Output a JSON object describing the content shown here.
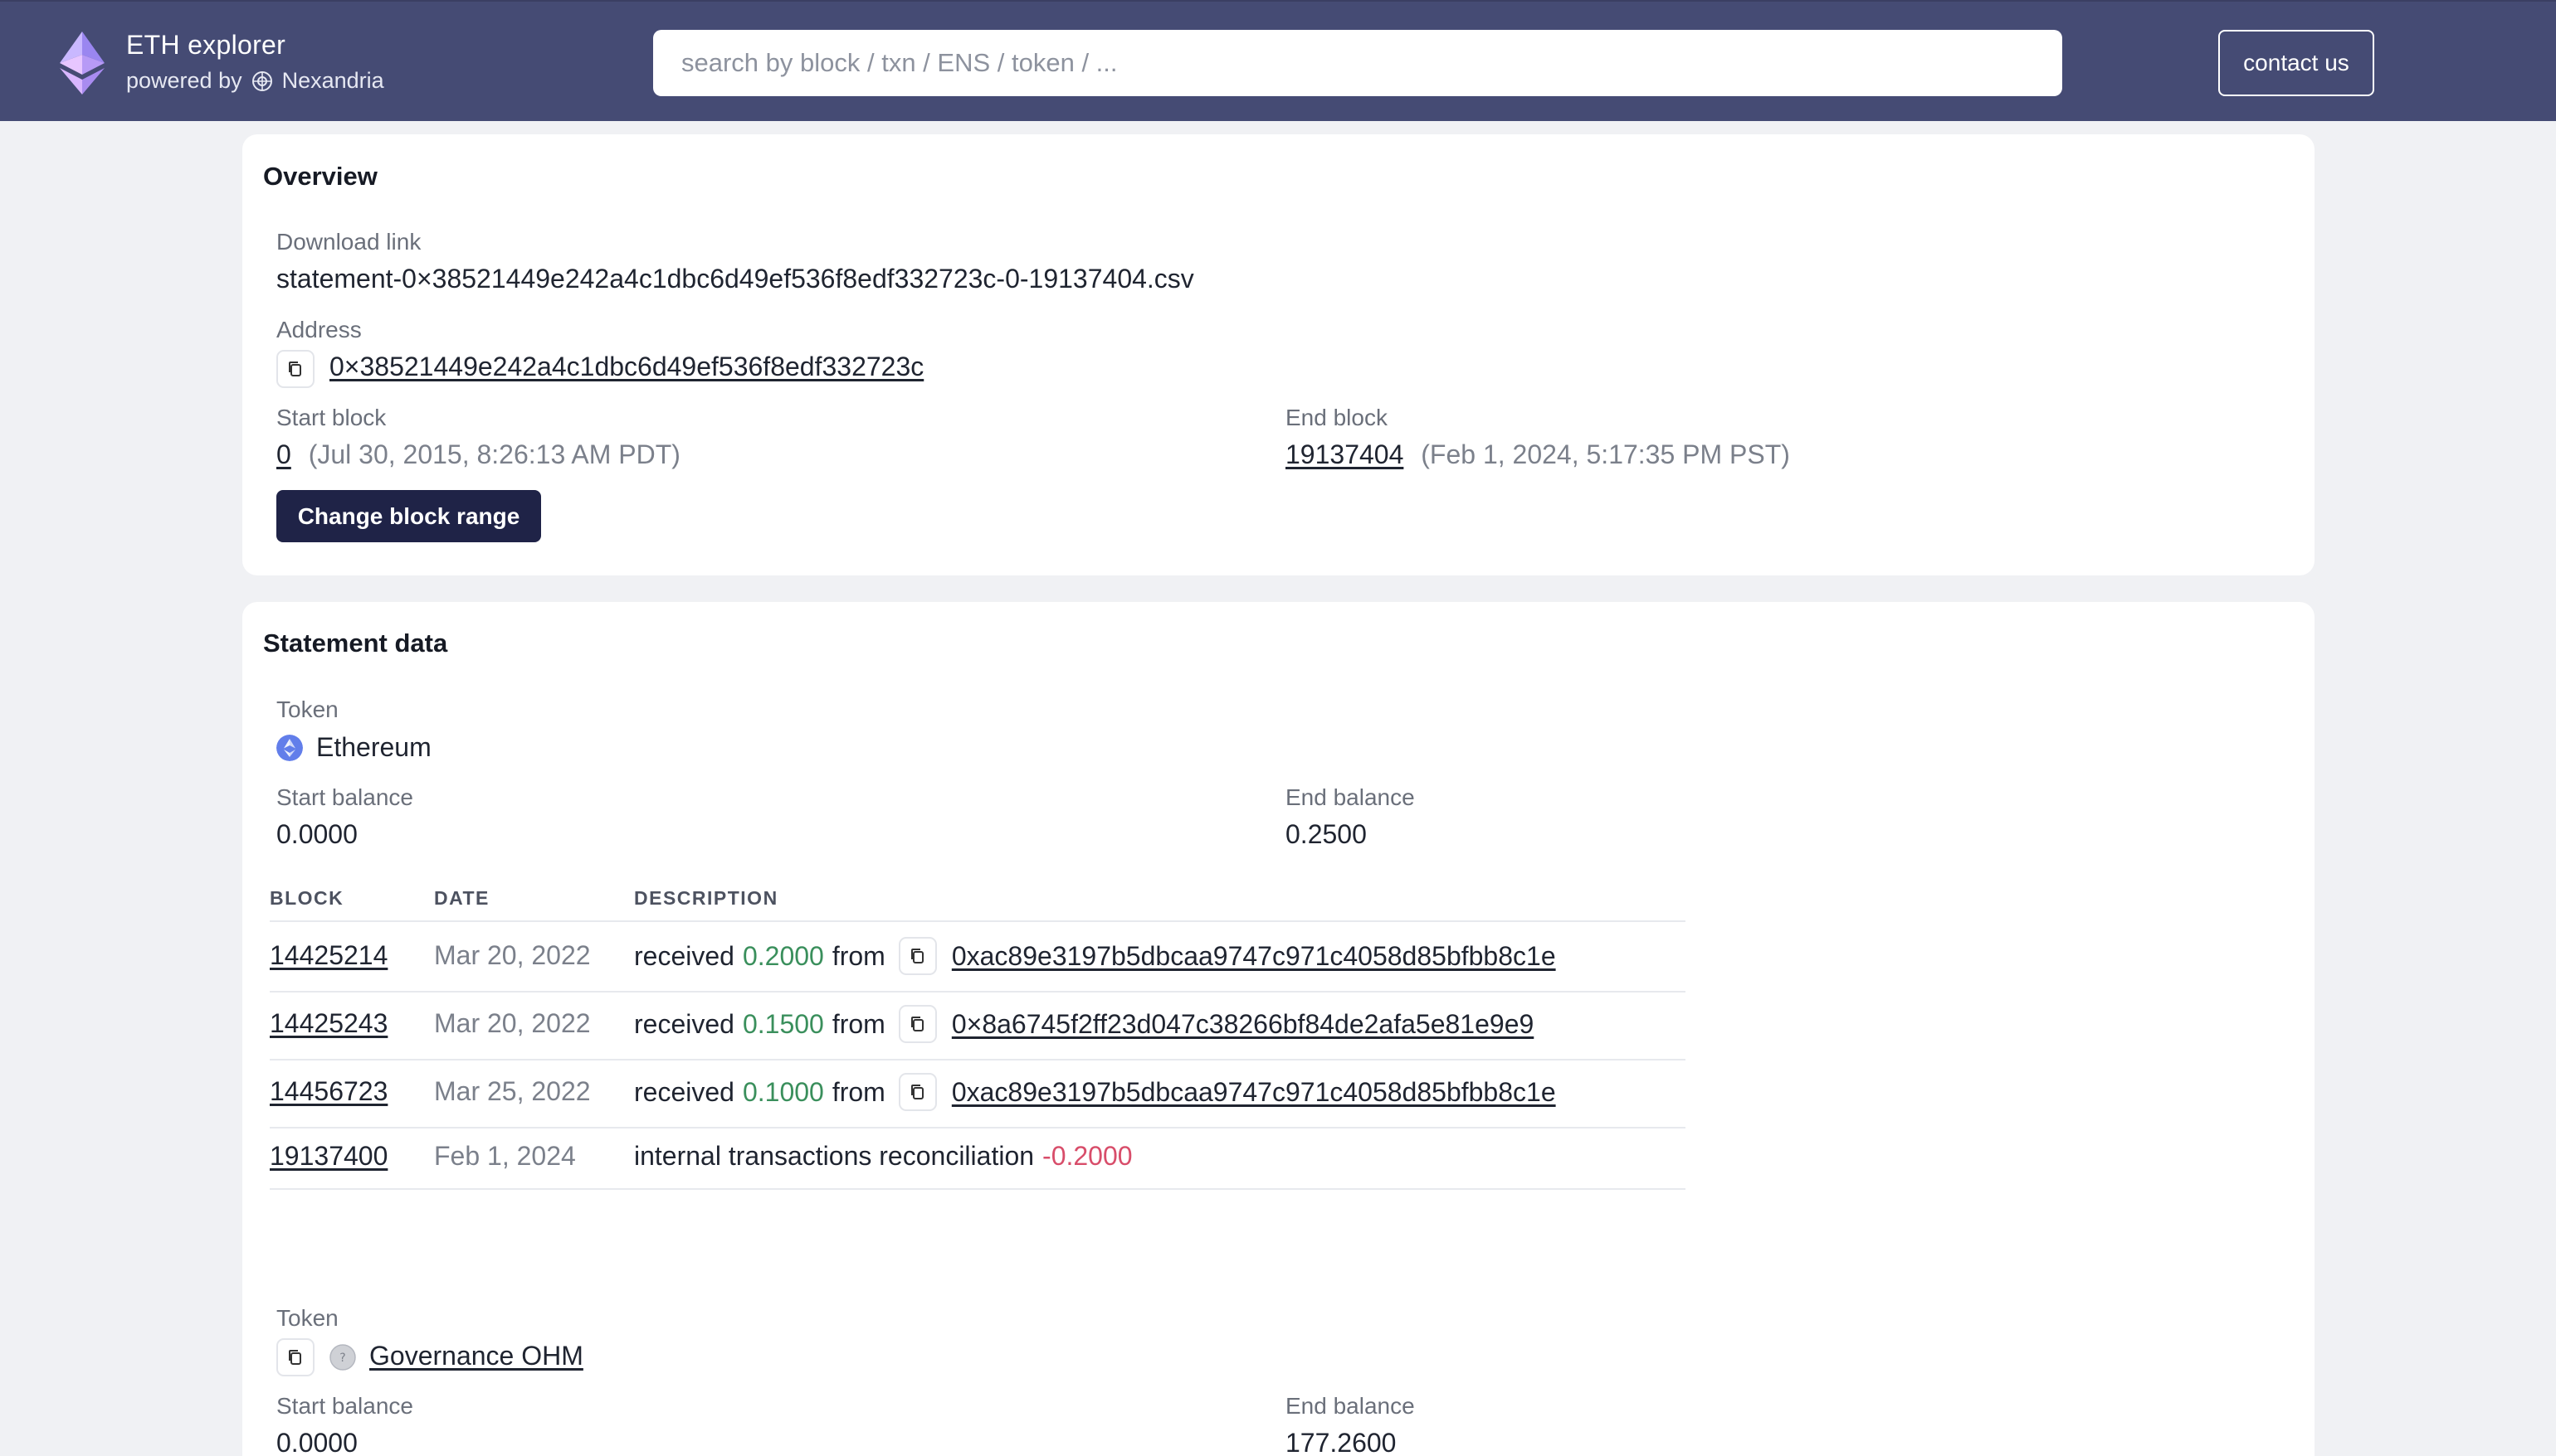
{
  "header": {
    "title": "ETH explorer",
    "powered_by": "powered by",
    "powered_name": "Nexandria",
    "search_placeholder": "search by block / txn / ENS / token / ...",
    "contact_label": "contact us"
  },
  "overview": {
    "title": "Overview",
    "download_label": "Download link",
    "download_value": "statement-0×38521449e242a4c1dbc6d49ef536f8edf332723c-0-19137404.csv",
    "address_label": "Address",
    "address_value": "0×38521449e242a4c1dbc6d49ef536f8edf332723c",
    "start_block_label": "Start block",
    "start_block": "0",
    "start_block_date": "(Jul 30, 2015, 8:26:13 AM PDT)",
    "end_block_label": "End block",
    "end_block": "19137404",
    "end_block_date": "(Feb 1, 2024, 5:17:35 PM PST)",
    "change_range_label": "Change block range"
  },
  "statement": {
    "title": "Statement data",
    "token_label": "Token",
    "token_name": "Ethereum",
    "start_balance_label": "Start balance",
    "start_balance": "0.0000",
    "end_balance_label": "End balance",
    "end_balance": "0.2500",
    "columns": [
      "BLOCK",
      "DATE",
      "DESCRIPTION"
    ],
    "rows": [
      {
        "block": "14425214",
        "date": "Mar 20, 2022",
        "prefix": "received",
        "amount": "0.2000",
        "suffix": "from",
        "address": "0xac89e3197b5dbcaa9747c971c4058d85bfbb8c1e"
      },
      {
        "block": "14425243",
        "date": "Mar 20, 2022",
        "prefix": "received",
        "amount": "0.1500",
        "suffix": "from",
        "address": "0×8a6745f2ff23d047c38266bf84de2afa5e81e9e9"
      },
      {
        "block": "14456723",
        "date": "Mar 25, 2022",
        "prefix": "received",
        "amount": "0.1000",
        "suffix": "from",
        "address": "0xac89e3197b5dbcaa9747c971c4058d85bfbb8c1e"
      },
      {
        "block": "19137400",
        "date": "Feb 1, 2024",
        "prefix": "internal transactions reconciliation",
        "amount": "-0.2000"
      }
    ],
    "token2_label": "Token",
    "token2_name": "Governance OHM",
    "start_balance2_label": "Start balance",
    "start_balance2": "0.0000",
    "end_balance2_label": "End balance",
    "end_balance2": "177.2600"
  },
  "colors": {
    "header_bg": "#454b74",
    "primary_button": "#1f2347",
    "positive": "#3a8f5c",
    "negative": "#d84d6a",
    "eth_icon": "#627eea"
  }
}
